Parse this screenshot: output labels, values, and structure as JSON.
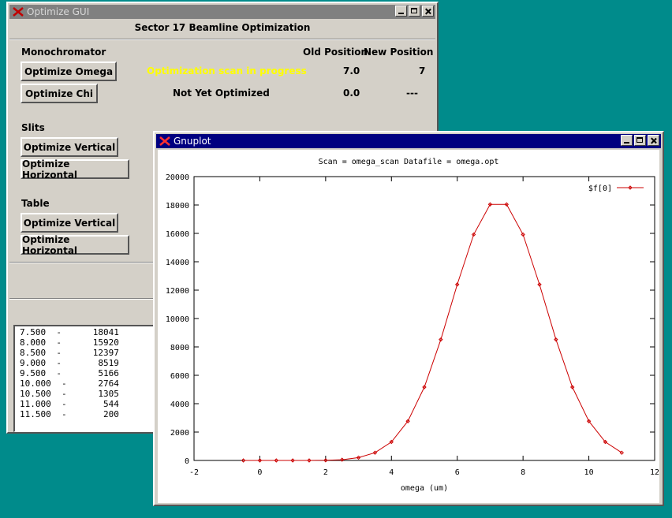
{
  "optimize_gui": {
    "title": "Optimize GUI",
    "header": "Sector 17 Beamline Optimization",
    "monochromator": {
      "label": "Monochromator",
      "col_old": "Old Position",
      "col_new": "New Position",
      "omega": {
        "button": "Optimize Omega",
        "status": "Optimization scan in progress",
        "old": "7.0",
        "new": "7"
      },
      "chi": {
        "button": "Optimize Chi",
        "status": "Not Yet Optimized",
        "old": "0.0",
        "new": "---"
      }
    },
    "slits": {
      "label": "Slits",
      "vertical": "Optimize Vertical",
      "horizontal": "Optimize Horizontal"
    },
    "table": {
      "label": "Table",
      "vertical": "Optimize Vertical",
      "horizontal": "Optimize Horizontal"
    },
    "log_lines": [
      "7.500  -      18041",
      "8.000  -      15920",
      "8.500  -      12397",
      "9.000  -       8519",
      "9.500  -       5166",
      "10.000  -      2764",
      "10.500  -      1305",
      "11.000  -       544",
      "11.500  -       200"
    ],
    "colors": {
      "status_in_progress": "#ffff00",
      "titlebar_inactive": "#808080"
    }
  },
  "gnuplot": {
    "title": "Gnuplot",
    "colors": {
      "titlebar_active": "#000080",
      "series": "#cc0000"
    },
    "chart_data": {
      "type": "line",
      "title": "Scan = omega_scan  Datafile = omega.opt",
      "xlabel": "omega (um)",
      "ylabel": "",
      "xlim": [
        -2,
        12
      ],
      "ylim": [
        0,
        20000
      ],
      "xticks": [
        -2,
        0,
        2,
        4,
        6,
        8,
        10,
        12
      ],
      "yticks": [
        0,
        2000,
        4000,
        6000,
        8000,
        10000,
        12000,
        14000,
        16000,
        18000,
        20000
      ],
      "legend_position": "top-right",
      "series": [
        {
          "name": "$f[0]",
          "x": [
            -0.5,
            0.0,
            0.5,
            1.0,
            1.5,
            2.0,
            2.5,
            3.0,
            3.5,
            4.0,
            4.5,
            5.0,
            5.5,
            6.0,
            6.5,
            7.0,
            7.5,
            8.0,
            8.5,
            9.0,
            9.5,
            10.0,
            10.5,
            11.0
          ],
          "y": [
            0,
            0,
            0,
            0,
            0,
            10,
            50,
            200,
            544,
            1305,
            2764,
            5166,
            8519,
            12397,
            15920,
            18041,
            18041,
            15920,
            12397,
            8519,
            5166,
            2764,
            1305,
            544
          ]
        }
      ]
    }
  }
}
